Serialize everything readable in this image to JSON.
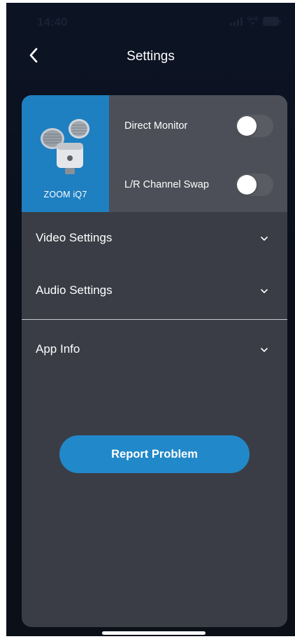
{
  "status_bar": {
    "time": "14:40"
  },
  "nav": {
    "title": "Settings"
  },
  "device": {
    "name": "ZOOM iQ7"
  },
  "toggles": [
    {
      "label": "Direct Monitor",
      "on": false
    },
    {
      "label": "L/R Channel Swap",
      "on": false
    }
  ],
  "sections": [
    {
      "label": "Video Settings"
    },
    {
      "label": "Audio Settings"
    },
    {
      "label": "App Info"
    }
  ],
  "actions": {
    "report_label": "Report Problem"
  },
  "colors": {
    "accent_blue": "#1e7fc1",
    "button_blue": "#2188c9",
    "panel": "#3a3d45",
    "toggle_panel": "#4c4f57",
    "background": "#0b0f18"
  }
}
